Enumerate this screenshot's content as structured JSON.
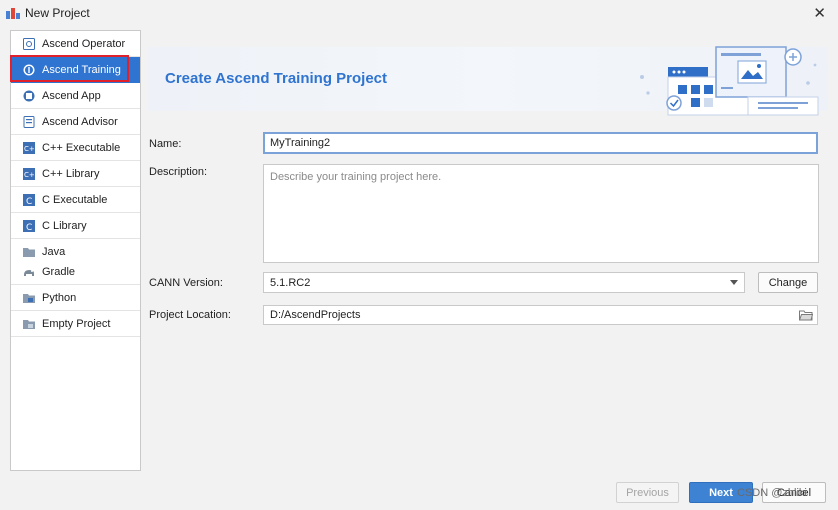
{
  "window": {
    "title": "New Project"
  },
  "sidebar": {
    "items": [
      {
        "label": "Ascend Operator",
        "icon": "operator-icon"
      },
      {
        "label": "Ascend Training",
        "icon": "training-icon",
        "selected": true
      },
      {
        "label": "Ascend App",
        "icon": "app-icon"
      },
      {
        "label": "Ascend Advisor",
        "icon": "advisor-icon"
      },
      {
        "label": "C++ Executable",
        "icon": "cpp-executable-icon"
      },
      {
        "label": "C++ Library",
        "icon": "cpp-library-icon"
      },
      {
        "label": "C Executable",
        "icon": "c-executable-icon"
      },
      {
        "label": "C Library",
        "icon": "c-library-icon"
      },
      {
        "label": "Java",
        "icon": "java-folder-icon"
      },
      {
        "label": "Gradle",
        "icon": "gradle-icon"
      },
      {
        "label": "Python",
        "icon": "python-icon"
      },
      {
        "label": "Empty Project",
        "icon": "empty-project-icon"
      }
    ]
  },
  "banner": {
    "title": "Create Ascend Training Project"
  },
  "form": {
    "name_label": "Name:",
    "name_value": "MyTraining2",
    "description_label": "Description:",
    "description_placeholder": "Describe your training project here.",
    "cann_label": "CANN Version:",
    "cann_value": "5.1.RC2",
    "change_label": "Change",
    "location_label": "Project Location:",
    "location_value": "D:/AscendProjects"
  },
  "footer": {
    "previous_label": "Previous",
    "next_label": "Next",
    "cancel_label": "Cancel"
  },
  "watermark": "CSDN @zhliki",
  "colors": {
    "accent": "#2f74d0",
    "selection_outline": "#e0202a",
    "primary_button": "#3e83d3"
  }
}
